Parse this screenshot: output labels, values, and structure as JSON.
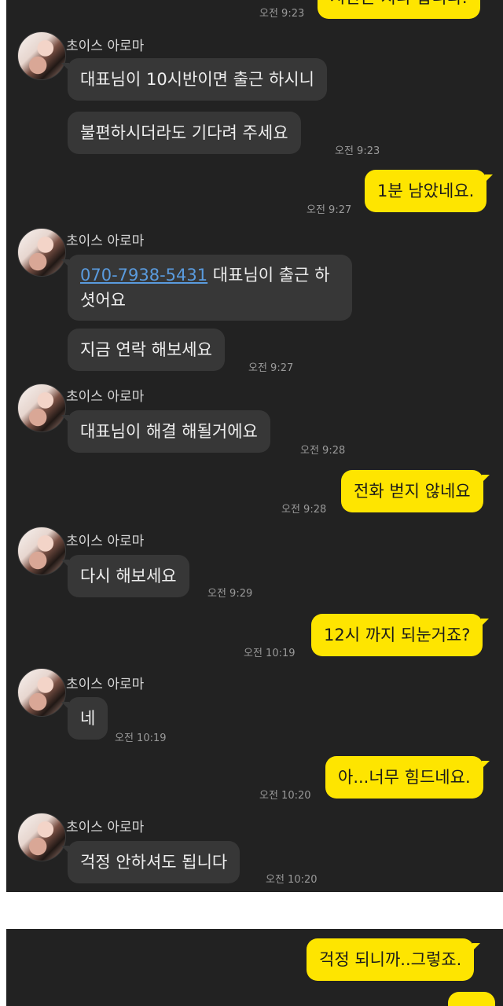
{
  "sender_name": "초이스 아로마",
  "messages": [
    {
      "id": "m0",
      "from": "me",
      "text": "시간은 지나 갑니다.",
      "time": "오전 9:23"
    },
    {
      "id": "m1",
      "from": "them",
      "text": "대표님이 10시반이면  출근 하시니"
    },
    {
      "id": "m2",
      "from": "them",
      "text": "불편하시더라도 기다려 주세요",
      "time": "오전 9:23"
    },
    {
      "id": "m3",
      "from": "me",
      "text": "1분 남았네요.",
      "time": "오전 9:27"
    },
    {
      "id": "m4",
      "from": "them",
      "phone": "070-7938-5431",
      "text": " 대표님이 출근 하셧어요"
    },
    {
      "id": "m5",
      "from": "them",
      "text": "지금 연락 해보세요",
      "time": "오전 9:27"
    },
    {
      "id": "m6",
      "from": "them",
      "text": "대표님이 해결 해될거에요",
      "time": "오전 9:28"
    },
    {
      "id": "m7",
      "from": "me",
      "text": "전화 벋지 않네요",
      "time": "오전 9:28"
    },
    {
      "id": "m8",
      "from": "them",
      "text": "다시 해보세요",
      "time": "오전 9:29"
    },
    {
      "id": "m9",
      "from": "me",
      "text": "12시 까지 되눈거죠?",
      "time": "오전 10:19"
    },
    {
      "id": "m10",
      "from": "them",
      "text": "네",
      "time": "오전 10:19"
    },
    {
      "id": "m11",
      "from": "me",
      "text": "아...너무 힘드네요.",
      "time": "오전 10:20"
    },
    {
      "id": "m12",
      "from": "them",
      "text": "걱정 안하셔도 됩니다",
      "time": "오전 10:20"
    },
    {
      "id": "m13",
      "from": "me",
      "text": "걱정 되니까..그렇죠."
    }
  ]
}
